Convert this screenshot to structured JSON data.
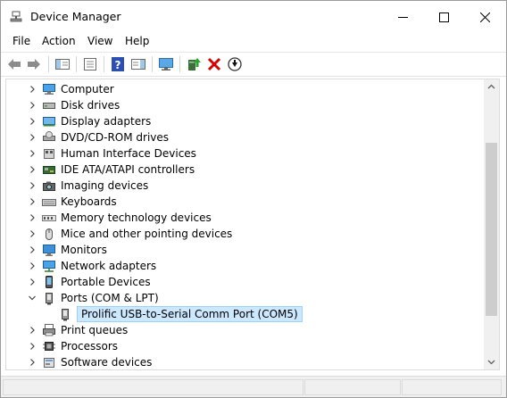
{
  "window": {
    "title": "Device Manager"
  },
  "menu": [
    "File",
    "Action",
    "View",
    "Help"
  ],
  "toolbar": {
    "buttons": [
      "back-icon",
      "forward-icon",
      "show-hide-console-tree-icon",
      "properties-icon",
      "help-icon",
      "action-pane-icon",
      "scan-hardware-icon",
      "update-driver-icon",
      "uninstall-icon",
      "disable-device-icon"
    ]
  },
  "tree": {
    "items": [
      {
        "label": "Computer",
        "icon": "computer-icon",
        "expanded": false
      },
      {
        "label": "Disk drives",
        "icon": "disk-drive-icon",
        "expanded": false
      },
      {
        "label": "Display adapters",
        "icon": "display-adapter-icon",
        "expanded": false
      },
      {
        "label": "DVD/CD-ROM drives",
        "icon": "dvd-drive-icon",
        "expanded": false
      },
      {
        "label": "Human Interface Devices",
        "icon": "hid-icon",
        "expanded": false
      },
      {
        "label": "IDE ATA/ATAPI controllers",
        "icon": "ide-controller-icon",
        "expanded": false
      },
      {
        "label": "Imaging devices",
        "icon": "camera-icon",
        "expanded": false
      },
      {
        "label": "Keyboards",
        "icon": "keyboard-icon",
        "expanded": false
      },
      {
        "label": "Memory technology devices",
        "icon": "memory-icon",
        "expanded": false
      },
      {
        "label": "Mice and other pointing devices",
        "icon": "mouse-icon",
        "expanded": false
      },
      {
        "label": "Monitors",
        "icon": "monitor-icon",
        "expanded": false
      },
      {
        "label": "Network adapters",
        "icon": "network-adapter-icon",
        "expanded": false
      },
      {
        "label": "Portable Devices",
        "icon": "portable-device-icon",
        "expanded": false
      },
      {
        "label": "Ports (COM & LPT)",
        "icon": "port-icon",
        "expanded": true
      },
      {
        "label": "Prolific USB-to-Serial Comm Port (COM5)",
        "icon": "port-icon",
        "child": true,
        "selected": true
      },
      {
        "label": "Print queues",
        "icon": "printer-icon",
        "expanded": false
      },
      {
        "label": "Processors",
        "icon": "processor-icon",
        "expanded": false
      },
      {
        "label": "Software devices",
        "icon": "software-device-icon",
        "expanded": false
      }
    ]
  },
  "colors": {
    "selection_bg": "#cce8ff",
    "selection_border": "#99d1ff",
    "uninstall_red": "#d80000",
    "icon_blue": "#1e78d2"
  }
}
